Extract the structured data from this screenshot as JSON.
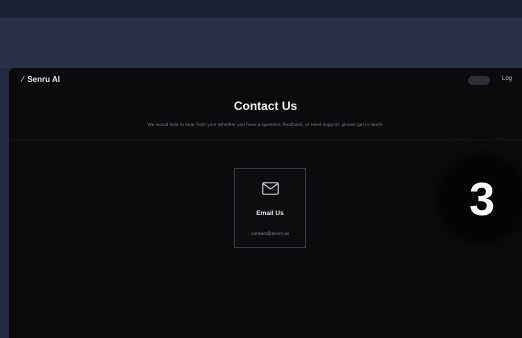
{
  "nav": {
    "brand": "Senru AI",
    "link": "Log"
  },
  "contact": {
    "title": "Contact Us",
    "subtitle": "We would love to hear from you! Whether you have a question, feedback, or need support, please get in touch.",
    "card": {
      "title": "Email Us",
      "email": "contact@senru.ai"
    }
  },
  "step_badge": "3",
  "colors": {
    "page_bg": "#232a3d",
    "frame_bg": "#0b0b0d",
    "text": "#f2f2f4"
  }
}
